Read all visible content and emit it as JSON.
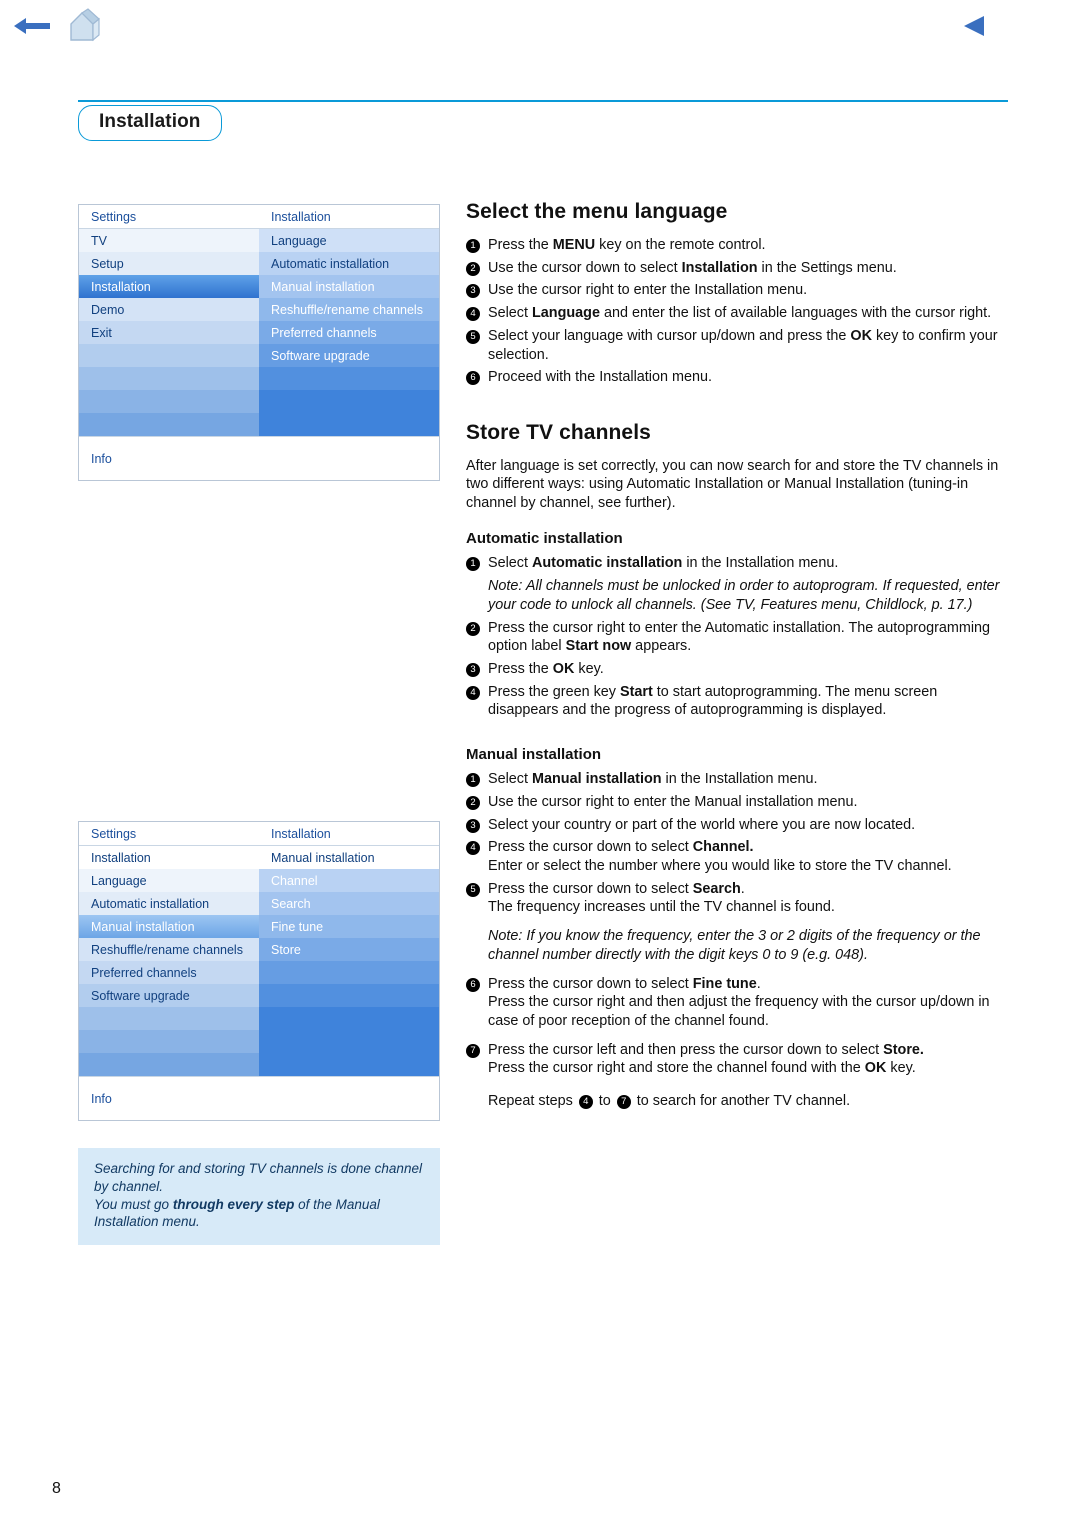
{
  "topbar": {
    "back_arrow": "left-arrow-icon",
    "home": "house-icon",
    "forward_arrow": "left-triangle-icon"
  },
  "page": {
    "title": "Installation",
    "number": "8"
  },
  "menu_top": {
    "col_left_header": "Settings",
    "col_right_header": "Installation",
    "left_items": [
      "TV",
      "Setup",
      "Installation",
      "Demo",
      "Exit"
    ],
    "left_selected": "Installation",
    "right_items": [
      "Language",
      "Automatic installation",
      "Manual installation",
      "Reshuffle/rename channels",
      "Preferred channels",
      "Software upgrade"
    ],
    "footer": "Info"
  },
  "menu_bottom": {
    "col_left_header": "Settings",
    "col_right_header": "Installation",
    "left_items": [
      "Installation",
      "Language",
      "Automatic installation",
      "Manual installation",
      "Reshuffle/rename channels",
      "Preferred channels",
      "Software upgrade"
    ],
    "left_selected": "Manual installation",
    "right_items": [
      "Manual installation",
      "Channel",
      "Search",
      "Fine tune",
      "Store"
    ],
    "footer": "Info"
  },
  "notebox": {
    "line1": "Searching for and storing TV channels is done channel by channel.",
    "line2_pre": "You must go ",
    "line2_bold": "through every step",
    "line2_post": " of the Manual Installation menu."
  },
  "section_language": {
    "title": "Select the menu language",
    "steps": [
      {
        "n": "1",
        "html": "Press the <b>MENU</b> key on the remote control."
      },
      {
        "n": "2",
        "html": "Use the cursor down to select <b>Installation</b> in the Settings menu."
      },
      {
        "n": "3",
        "html": "Use the cursor right to enter the Installation menu."
      },
      {
        "n": "4",
        "html": "Select <b>Language</b> and enter the list of available languages with the cursor right."
      },
      {
        "n": "5",
        "html": "Select your language with cursor up/down and press the <b>OK</b> key to confirm your selection."
      },
      {
        "n": "6",
        "html": "Proceed with the Installation menu."
      }
    ]
  },
  "section_store": {
    "title": "Store TV channels",
    "intro": "After language is set correctly, you can now search for and store the TV channels in two different ways: using Automatic Installation or Manual Installation (tuning-in channel by channel, see further).",
    "auto_title": "Automatic installation",
    "auto_steps": [
      {
        "n": "1",
        "html": "Select <b>Automatic installation</b> in the Installation menu."
      },
      {
        "n": "",
        "html": "<i>Note: All channels must be unlocked in order to autoprogram. If requested, enter your code to unlock all channels. (See TV, Features menu, Childlock, p. 17.)</i>"
      },
      {
        "n": "2",
        "html": "Press the cursor right to enter the Automatic installation. The autoprogramming option label <b>Start now</b> appears."
      },
      {
        "n": "3",
        "html": "Press the <b>OK</b> key."
      },
      {
        "n": "4",
        "html": "Press the green key <b>Start</b> to start autoprogramming. The menu screen disappears and the progress of autoprogramming is displayed."
      }
    ],
    "manual_title": "Manual installation",
    "manual_steps": [
      {
        "n": "1",
        "html": "Select <b>Manual installation</b> in the Installation menu."
      },
      {
        "n": "2",
        "html": "Use the cursor right to enter the Manual installation menu."
      },
      {
        "n": "3",
        "html": "Select your country or part of the world where you are now located."
      },
      {
        "n": "4",
        "html": "Press the cursor down to select <b>Channel.</b><br>Enter or select the number where you would like to store the TV channel."
      },
      {
        "n": "5",
        "html": "Press the cursor down to select <b>Search</b>.<br>The frequency increases until the TV channel is found."
      },
      {
        "n": "",
        "html": "<i>Note: If you know the frequency, enter the 3 or 2 digits of the frequency or the channel number directly with the digit keys 0 to 9 (e.g. 048).</i>"
      },
      {
        "n": "6",
        "html": "Press the cursor down to select <b>Fine tune</b>.<br>Press the cursor right and then adjust the frequency with the cursor up/down in case of poor reception of the channel found."
      },
      {
        "n": "7",
        "html": "Press the cursor left and then press the cursor down to select <b>Store.</b><br>Press the cursor right and store the channel found with the <b>OK</b> key."
      }
    ],
    "repeat_pre": "Repeat steps ",
    "repeat_a": "4",
    "repeat_mid": " to ",
    "repeat_b": "7",
    "repeat_post": " to search for another TV channel."
  },
  "colors": {
    "accent": "#0a9ad8",
    "menu_select": "#2f72cf",
    "note_bg": "#d7eaf8"
  }
}
